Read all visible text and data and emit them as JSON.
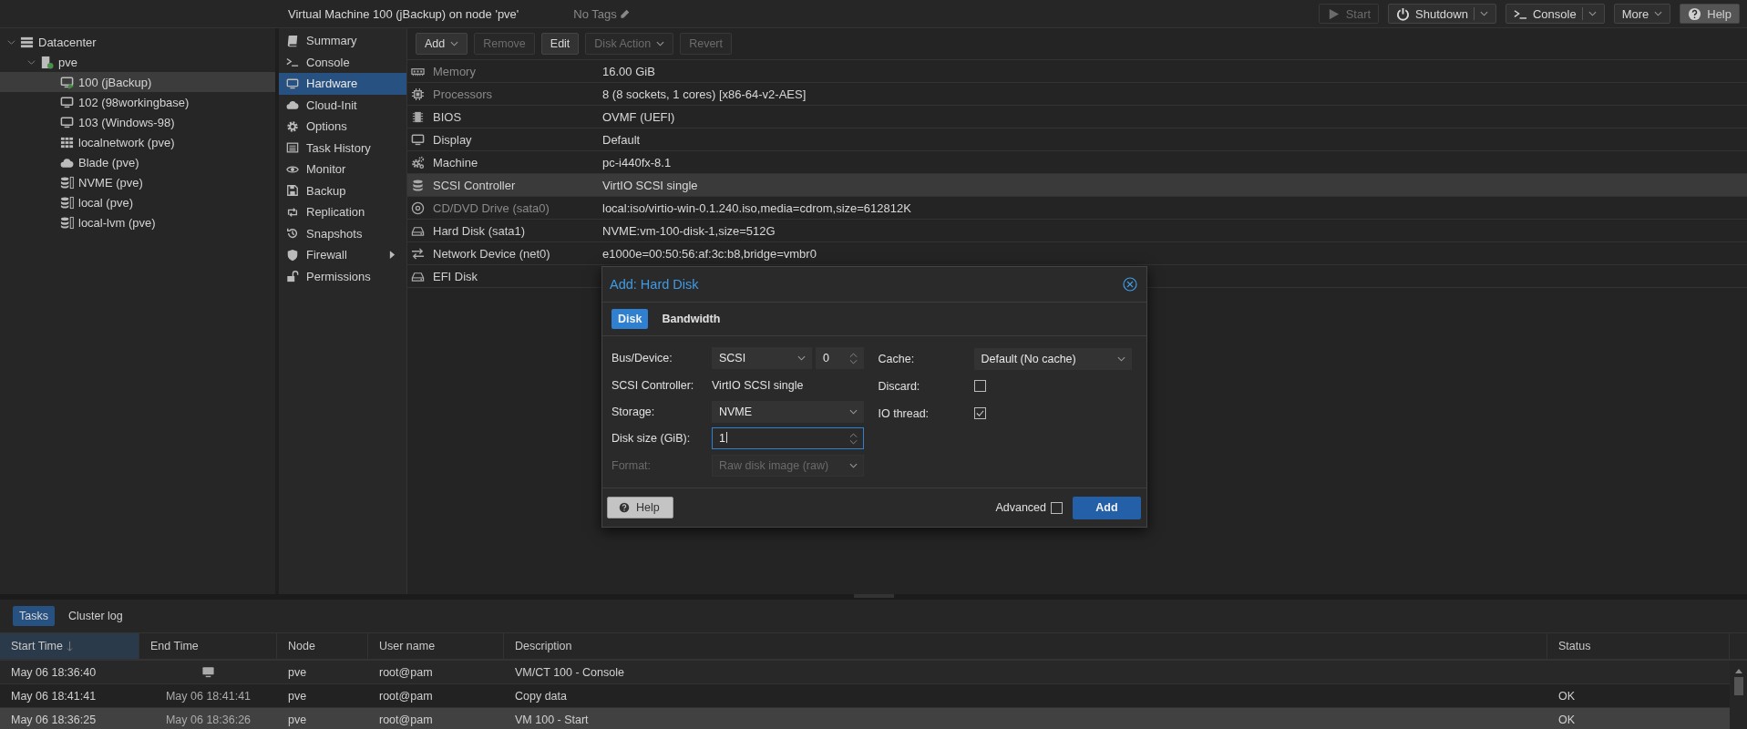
{
  "header": {
    "title": "Virtual Machine 100 (jBackup) on node 'pve'",
    "tags": "No Tags",
    "buttons": [
      {
        "label": "Start",
        "kind": "play",
        "disabled": true,
        "split": false,
        "dropdown": false
      },
      {
        "label": "Shutdown",
        "kind": "power",
        "disabled": false,
        "split": true,
        "dropdown": true
      },
      {
        "label": "Console",
        "kind": "terminal",
        "disabled": false,
        "split": true,
        "dropdown": true
      },
      {
        "label": "More",
        "kind": "plain",
        "disabled": false,
        "split": false,
        "dropdown": true
      },
      {
        "label": "Help",
        "kind": "question",
        "disabled": false,
        "split": false,
        "dropdown": false
      }
    ]
  },
  "tree": [
    {
      "label": "Datacenter",
      "kind": "datacenter",
      "expanded": true,
      "selected": false,
      "children": [
        {
          "label": "pve",
          "kind": "node",
          "expanded": true,
          "selected": false,
          "children": [
            {
              "label": "100 (jBackup)",
              "kind": "vm-running",
              "selected": true
            },
            {
              "label": "102 (98workingbase)",
              "kind": "vm",
              "selected": false
            },
            {
              "label": "103 (Windows-98)",
              "kind": "vm",
              "selected": false
            },
            {
              "label": "localnetwork (pve)",
              "kind": "sdn",
              "selected": false
            },
            {
              "label": "Blade (pve)",
              "kind": "cloud",
              "selected": false
            },
            {
              "label": "NVME (pve)",
              "kind": "storage",
              "selected": false
            },
            {
              "label": "local (pve)",
              "kind": "storage",
              "selected": false
            },
            {
              "label": "local-lvm (pve)",
              "kind": "storage",
              "selected": false
            }
          ]
        }
      ]
    }
  ],
  "nav": [
    {
      "label": "Summary",
      "kind": "book",
      "selected": false,
      "expandable": false
    },
    {
      "label": "Console",
      "kind": "terminal",
      "selected": false,
      "expandable": false
    },
    {
      "label": "Hardware",
      "kind": "monitor",
      "selected": true,
      "expandable": false
    },
    {
      "label": "Cloud-Init",
      "kind": "cloud",
      "selected": false,
      "expandable": false
    },
    {
      "label": "Options",
      "kind": "gear",
      "selected": false,
      "expandable": false
    },
    {
      "label": "Task History",
      "kind": "list",
      "selected": false,
      "expandable": false
    },
    {
      "label": "Monitor",
      "kind": "eye",
      "selected": false,
      "expandable": false
    },
    {
      "label": "Backup",
      "kind": "floppy",
      "selected": false,
      "expandable": false
    },
    {
      "label": "Replication",
      "kind": "retweet",
      "selected": false,
      "expandable": false
    },
    {
      "label": "Snapshots",
      "kind": "history",
      "selected": false,
      "expandable": false
    },
    {
      "label": "Firewall",
      "kind": "shield",
      "selected": false,
      "expandable": true
    },
    {
      "label": "Permissions",
      "kind": "unlock",
      "selected": false,
      "expandable": false
    }
  ],
  "toolbar": [
    {
      "label": "Add",
      "disabled": false,
      "dropdown": true
    },
    {
      "label": "Remove",
      "disabled": true,
      "dropdown": false
    },
    {
      "label": "Edit",
      "disabled": false,
      "dropdown": false
    },
    {
      "label": "Disk Action",
      "disabled": true,
      "dropdown": true
    },
    {
      "label": "Revert",
      "disabled": true,
      "dropdown": false
    }
  ],
  "hardware": [
    {
      "kind": "memory",
      "name": "Memory",
      "value": "16.00 GiB",
      "dimmed": true,
      "selected": false
    },
    {
      "kind": "cpu",
      "name": "Processors",
      "value": "8 (8 sockets, 1 cores) [x86-64-v2-AES]",
      "dimmed": true,
      "selected": false
    },
    {
      "kind": "chip",
      "name": "BIOS",
      "value": "OVMF (UEFI)",
      "dimmed": false,
      "selected": false
    },
    {
      "kind": "monitor",
      "name": "Display",
      "value": "Default",
      "dimmed": false,
      "selected": false
    },
    {
      "kind": "gears",
      "name": "Machine",
      "value": "pc-i440fx-8.1",
      "dimmed": false,
      "selected": false
    },
    {
      "kind": "database",
      "name": "SCSI Controller",
      "value": "VirtIO SCSI single",
      "dimmed": false,
      "selected": true
    },
    {
      "kind": "disc",
      "name": "CD/DVD Drive (sata0)",
      "value": "local:iso/virtio-win-0.1.240.iso,media=cdrom,size=612812K",
      "dimmed": true,
      "selected": false
    },
    {
      "kind": "harddisk",
      "name": "Hard Disk (sata1)",
      "value": "NVME:vm-100-disk-1,size=512G",
      "dimmed": false,
      "selected": false
    },
    {
      "kind": "exchange",
      "name": "Network Device (net0)",
      "value": "e1000e=00:50:56:af:3c:b8,bridge=vmbr0",
      "dimmed": false,
      "selected": false
    },
    {
      "kind": "harddisk",
      "name": "EFI Disk",
      "dimmed": false,
      "selected": false
    }
  ],
  "dialog": {
    "title": "Add: Hard Disk",
    "tabs": [
      {
        "label": "Disk",
        "selected": true
      },
      {
        "label": "Bandwidth",
        "selected": false
      }
    ],
    "bus_label": "Bus/Device:",
    "bus_value": "SCSI",
    "device_value": "0",
    "controller_label": "SCSI Controller:",
    "controller_value": "VirtIO SCSI single",
    "storage_label": "Storage:",
    "storage_value": "NVME",
    "size_label": "Disk size (GiB):",
    "size_value": "1",
    "format_label": "Format:",
    "format_value": "Raw disk image (raw)",
    "format_disabled": true,
    "cache_label": "Cache:",
    "cache_value": "Default (No cache)",
    "discard_label": "Discard:",
    "discard_checked": false,
    "iothread_label": "IO thread:",
    "iothread_checked": true,
    "help_button": "Help",
    "advanced_label": "Advanced",
    "advanced_checked": false,
    "add_button": "Add"
  },
  "bottom": {
    "tabs": [
      {
        "label": "Tasks",
        "selected": true
      },
      {
        "label": "Cluster log",
        "selected": false
      }
    ],
    "columns": [
      {
        "label": "Start Time",
        "sorted": true
      },
      {
        "label": "End Time",
        "sorted": false
      },
      {
        "label": "Node",
        "sorted": false
      },
      {
        "label": "User name",
        "sorted": false
      },
      {
        "label": "Description",
        "sorted": false
      },
      {
        "label": "Status",
        "sorted": false
      }
    ],
    "rows": [
      {
        "start": "May 06 18:36:40",
        "running": true,
        "node": "pve",
        "user": "root@pam",
        "description": "VM/CT 100 - Console",
        "selected": false
      },
      {
        "start": "May 06 18:41:41",
        "running": false,
        "end": "May 06 18:41:41",
        "node": "pve",
        "user": "root@pam",
        "description": "Copy data",
        "status": "OK",
        "selected": false
      },
      {
        "start": "May 06 18:36:25",
        "running": false,
        "end": "May 06 18:36:26",
        "node": "pve",
        "user": "root@pam",
        "description": "VM 100 - Start",
        "status": "OK",
        "selected": true
      }
    ]
  }
}
